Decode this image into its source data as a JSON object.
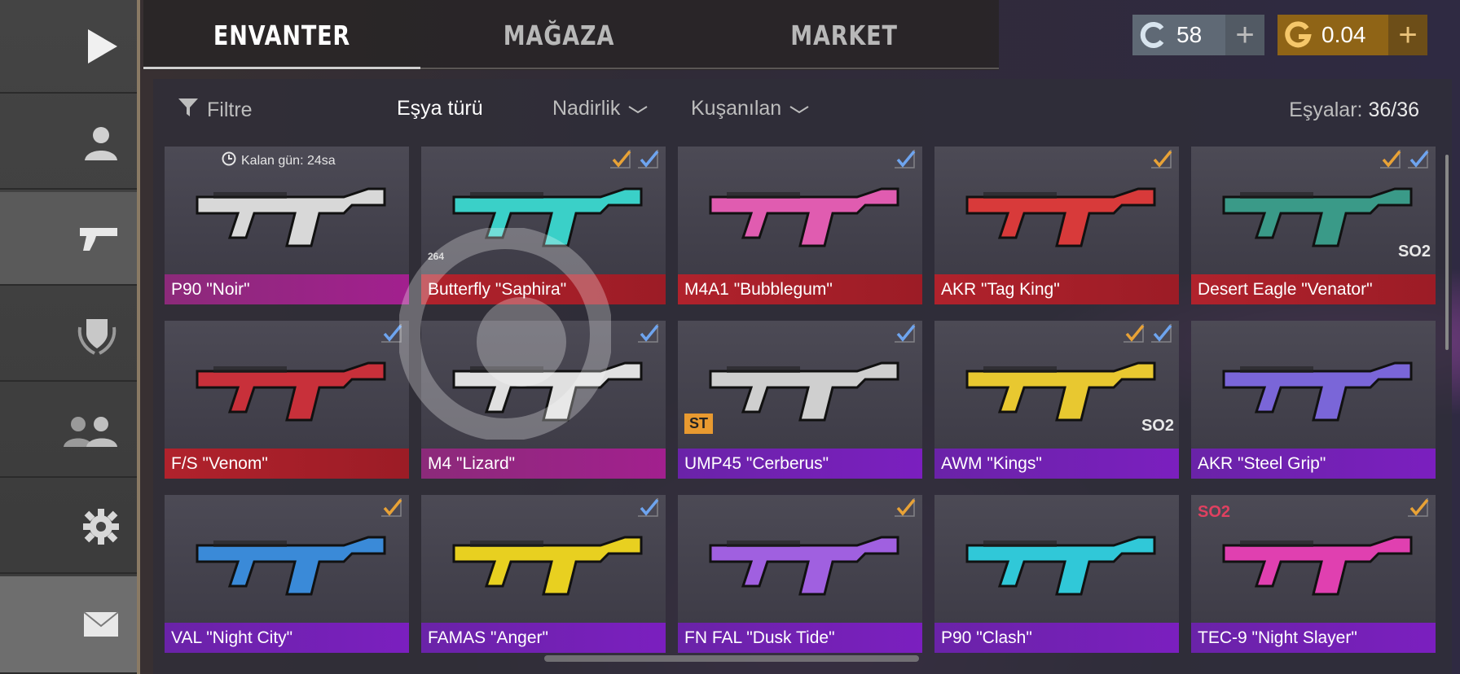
{
  "tabs": [
    {
      "label": "ENVANTER",
      "active": true
    },
    {
      "label": "MAĞAZA",
      "active": false
    },
    {
      "label": "MARKET",
      "active": false
    }
  ],
  "currency": {
    "silver": {
      "value": "58",
      "icon": "silver-coin-icon"
    },
    "gold": {
      "value": "0.04",
      "icon": "gold-coin-icon"
    }
  },
  "sidebar": [
    {
      "name": "play",
      "icon": "play-icon"
    },
    {
      "name": "profile",
      "icon": "user-icon"
    },
    {
      "name": "inventory",
      "icon": "pistol-icon"
    },
    {
      "name": "clan",
      "icon": "shield-laurel-icon"
    },
    {
      "name": "friends",
      "icon": "friends-icon"
    },
    {
      "name": "settings",
      "icon": "gear-icon"
    },
    {
      "name": "mail",
      "icon": "envelope-icon"
    }
  ],
  "filters": {
    "filter_label": "Filtre",
    "item_type_label": "Eşya türü",
    "rarity_label": "Nadirlik",
    "equipped_label": "Kuşanılan",
    "count_label": "Eşyalar:",
    "count_value": "36/36"
  },
  "items": [
    {
      "name": "P90 \"Noir\"",
      "rarity": "pink",
      "timer": "Kalan gün: 24sa",
      "checks": [],
      "color": "#d8d8d8"
    },
    {
      "name": "Butterfly \"Saphira\"",
      "rarity": "red",
      "checks": [
        "o",
        "b"
      ],
      "badge": "264",
      "color": "#3ad0c8"
    },
    {
      "name": "M4A1 \"Bubblegum\"",
      "rarity": "red",
      "checks": [
        "b"
      ],
      "color": "#e05cb0"
    },
    {
      "name": "AKR \"Tag King\"",
      "rarity": "red",
      "checks": [
        "o"
      ],
      "color": "#d83a3a"
    },
    {
      "name": "Desert Eagle \"Venator\"",
      "rarity": "red",
      "checks": [
        "o",
        "b"
      ],
      "badge": "SO2",
      "color": "#3a9a88"
    },
    {
      "name": "F/S \"Venom\"",
      "rarity": "red",
      "checks": [
        "b"
      ],
      "color": "#c8303a"
    },
    {
      "name": "M4 \"Lizard\"",
      "rarity": "pink",
      "checks": [
        "b"
      ],
      "color": "#e0e0e0"
    },
    {
      "name": "UMP45 \"Cerberus\"",
      "rarity": "purple",
      "checks": [
        "b"
      ],
      "badge": "ST",
      "color": "#cfcfcf"
    },
    {
      "name": "AWM \"Kings\"",
      "rarity": "purple",
      "checks": [
        "o",
        "b"
      ],
      "badge": "SO2",
      "color": "#e8c830"
    },
    {
      "name": "AKR \"Steel Grip\"",
      "rarity": "purple",
      "checks": [],
      "color": "#7a66d8"
    },
    {
      "name": "VAL \"Night City\"",
      "rarity": "purple",
      "checks": [
        "o"
      ],
      "color": "#3a8ad8"
    },
    {
      "name": "FAMAS \"Anger\"",
      "rarity": "purple",
      "checks": [
        "b"
      ],
      "color": "#e8d020"
    },
    {
      "name": "FN FAL \"Dusk Tide\"",
      "rarity": "purple",
      "checks": [
        "o"
      ],
      "color": "#a060e0"
    },
    {
      "name": "P90 \"Clash\"",
      "rarity": "purple",
      "checks": [],
      "color": "#30c8d8"
    },
    {
      "name": "TEC-9 \"Night Slayer\"",
      "rarity": "purple",
      "checks": [
        "o"
      ],
      "badge": "SO2",
      "color": "#e040b0"
    }
  ],
  "colors": {
    "rarity_red": "#b0222c",
    "rarity_pink": "#a2208e",
    "rarity_purple": "#7b1fbf",
    "check_orange": "#e8a236",
    "check_blue": "#6ea4ef"
  }
}
